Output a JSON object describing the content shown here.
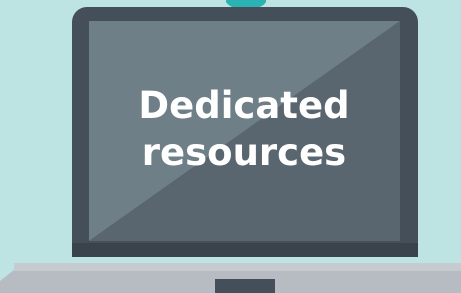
{
  "screen": {
    "line1": "Dedicated",
    "line2": "resources"
  },
  "colors": {
    "background": "#bde3e2",
    "laptop_frame": "#444f5a",
    "screen_light": "#6f7f87",
    "screen_dark": "#5a666f",
    "base": "#b6bcc1",
    "webcam": "#2bb3b3"
  },
  "icons": {
    "laptop": "laptop-icon"
  }
}
